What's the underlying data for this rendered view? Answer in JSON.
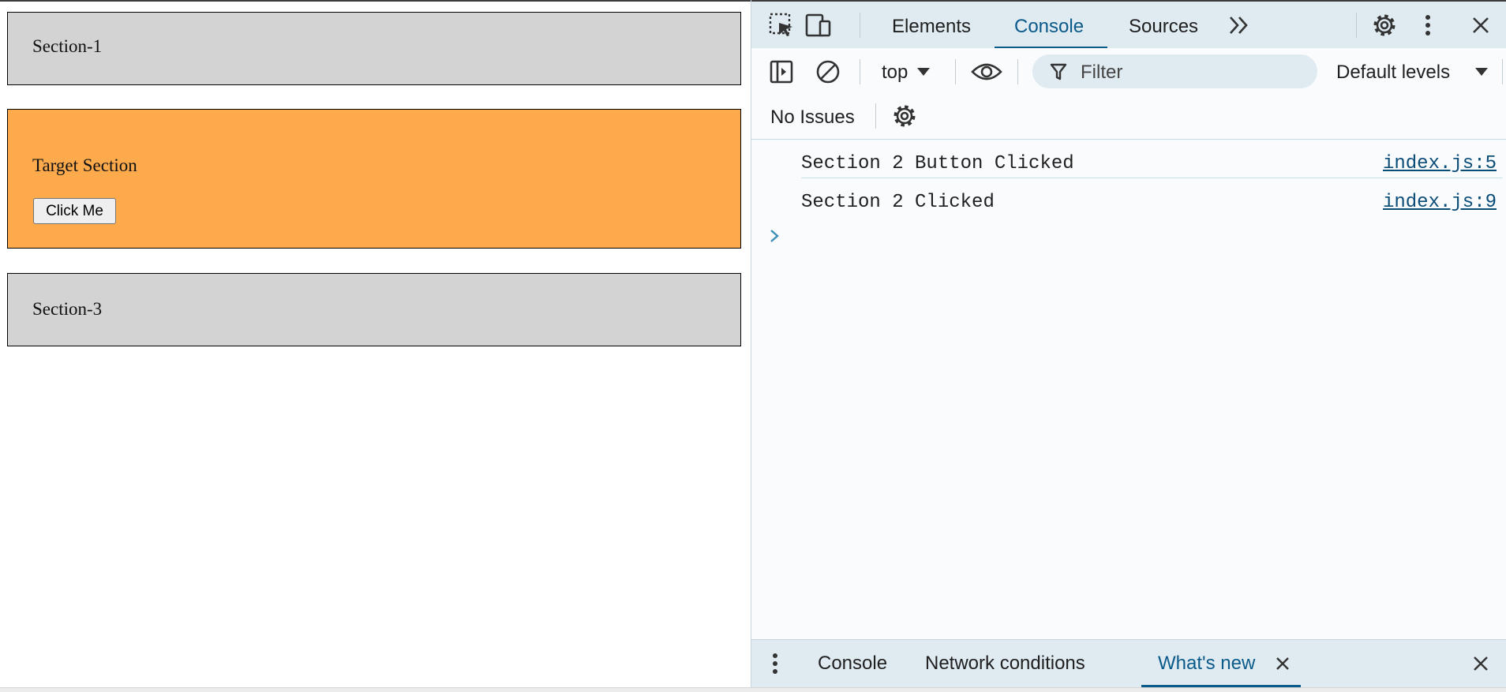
{
  "page": {
    "sections": [
      {
        "title": "Section-1"
      },
      {
        "title": "Target Section",
        "button_label": "Click Me"
      },
      {
        "title": "Section-3"
      }
    ],
    "colors": {
      "highlight": "#fdaa4d",
      "section_bg": "#d3d3d3"
    }
  },
  "devtools": {
    "tabs": [
      {
        "label": "Elements",
        "active": false
      },
      {
        "label": "Console",
        "active": true
      },
      {
        "label": "Sources",
        "active": false
      }
    ],
    "icons": [
      "inspect-element-icon",
      "device-toolbar-icon",
      "more-tabs-icon",
      "settings-icon",
      "more-options-icon",
      "close-icon"
    ],
    "toolbar": {
      "context": "top",
      "filter_placeholder": "Filter",
      "levels": "Default levels"
    },
    "issues": "No Issues",
    "logs": [
      {
        "message": "Section 2 Button Clicked",
        "source": "index.js:5"
      },
      {
        "message": "Section 2 Clicked",
        "source": "index.js:9"
      }
    ],
    "drawer": {
      "tabs": [
        {
          "label": "Console",
          "active": false
        },
        {
          "label": "Network conditions",
          "active": false
        },
        {
          "label": "What's new",
          "active": true
        }
      ]
    },
    "accent_color": "#0a5a8a"
  }
}
